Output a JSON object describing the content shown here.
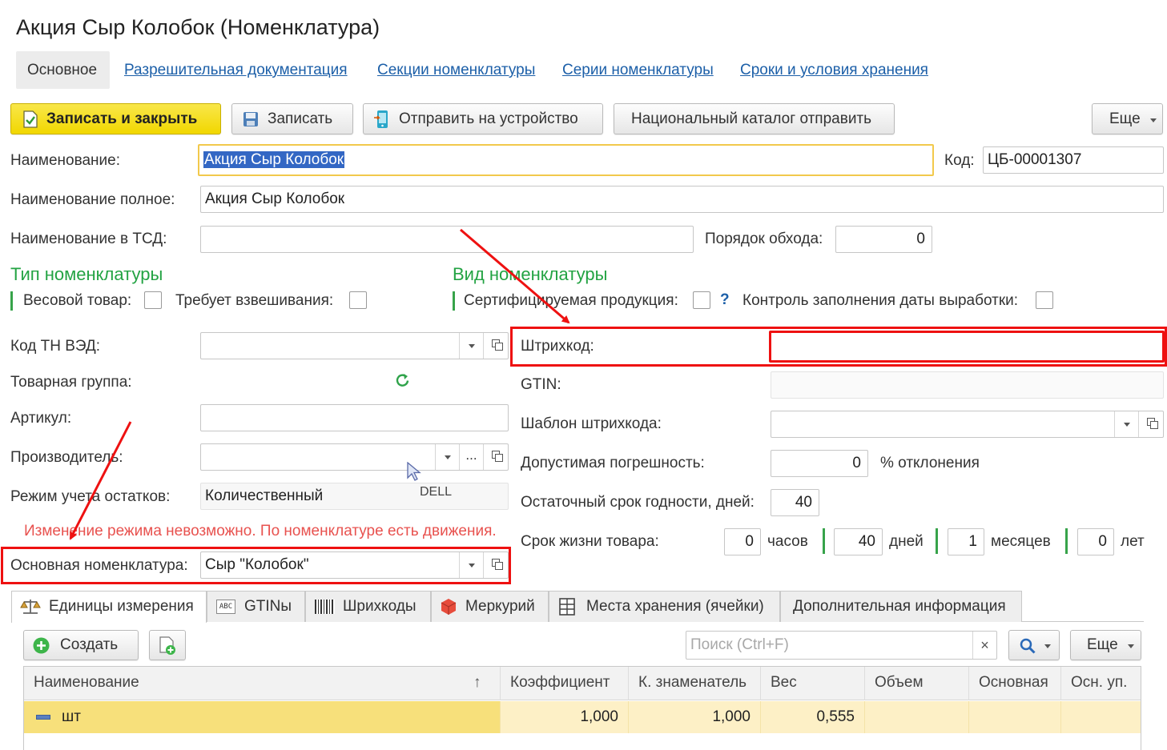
{
  "window": {
    "title": "Акция  Сыр Колобок (Номенклатура)"
  },
  "nav_tabs": [
    "Основное",
    "Разрешительная документация",
    "Секции номенклатуры",
    "Серии номенклатуры",
    "Сроки и условия хранения"
  ],
  "toolbar": {
    "save_close": "Записать и закрыть",
    "save": "Записать",
    "send_device": "Отправить на устройство",
    "national_catalog": "Национальный каталог отправить",
    "more": "Еще"
  },
  "form": {
    "name_label": "Наименование:",
    "name_value": "Акция  Сыр Колобок",
    "code_label": "Код:",
    "code_value": "ЦБ-00001307",
    "full_name_label": "Наименование полное:",
    "full_name_value": "Акция  Сыр Колобок",
    "tsd_name_label": "Наименование в ТСД:",
    "tsd_name_value": "",
    "traverse_order_label": "Порядок обхода:",
    "traverse_order_value": "0",
    "type_heading": "Тип номенклатуры",
    "weight_item_label": "Весовой товар:",
    "requires_weighing_label": "Требует взвешивания:",
    "kind_heading": "Вид номенклатуры",
    "certified_label": "Сертифицируемая продукция:",
    "help_mark": "?",
    "production_date_control_label": "Контроль заполнения даты выработки:",
    "tnved_label": "Код ТН ВЭД:",
    "tnved_value": "",
    "product_group_label": "Товарная группа:",
    "article_label": "Артикул:",
    "article_value": "",
    "manufacturer_label": "Производитель:",
    "manufacturer_value": "",
    "dots": "...",
    "stock_mode_label": "Режим учета остатков:",
    "stock_mode_value": "Количественный",
    "tooltip": "DELL",
    "warning": "Изменение режима невозможно. По номенклатуре есть движения.",
    "main_item_label": "Основная номенклатура:",
    "main_item_value": "Сыр \"Колобок\"",
    "barcode_label": "Штрихкод:",
    "barcode_value": "",
    "gtin_label": "GTIN:",
    "gtin_value": "",
    "barcode_template_label": "Шаблон штрихкода:",
    "barcode_template_value": "",
    "tolerance_label": "Допустимая погрешность:",
    "tolerance_value": "0",
    "tolerance_unit": "% отклонения",
    "residual_shelf_label": "Остаточный срок годности, дней:",
    "residual_shelf_value": "40",
    "lifetime_label": "Срок жизни товара:",
    "lifetime_hours": "0",
    "hours_unit": "часов",
    "lifetime_days": "40",
    "days_unit": "дней",
    "lifetime_months": "1",
    "months_unit": "месяцев",
    "lifetime_years": "0",
    "years_unit": "лет"
  },
  "bottom_tabs": [
    "Единицы измерения",
    "GTINы",
    "Шрихкоды",
    "Меркурий",
    "Места хранения (ячейки)",
    "Дополнительная информация"
  ],
  "units_toolbar": {
    "create": "Создать",
    "search_placeholder": "Поиск (Ctrl+F)",
    "clear": "×",
    "more": "Еще"
  },
  "units_table": {
    "columns": [
      "Наименование",
      "Коэффициент",
      "К. знаменатель",
      "Вес",
      "Объем",
      "Основная",
      "Осн. уп."
    ],
    "sort_arrow": "↑",
    "rows": [
      {
        "name": "шт",
        "coef": "1,000",
        "denom": "1,000",
        "weight": "0,555",
        "volume": "",
        "main": "",
        "main_pack": ""
      }
    ]
  },
  "colors": {
    "accent_yellow": "#f5e01b",
    "link": "#1c5fa8",
    "heading_green": "#23a343",
    "warning_red": "#e8524f",
    "annotation_red": "#ee1111",
    "selected_row": "#fdf0c6"
  }
}
